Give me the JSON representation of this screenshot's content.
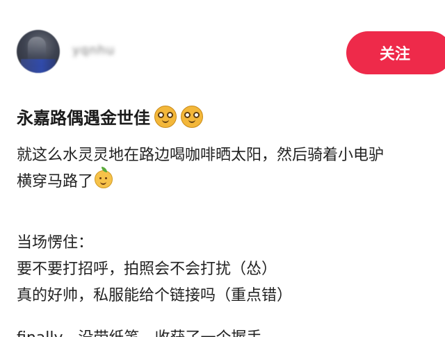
{
  "author": {
    "avatar_icon": "user-avatar-icon",
    "name": "yqnhu"
  },
  "follow_button": {
    "label": "关注",
    "color": "#ee2a4a"
  },
  "post": {
    "title": "永嘉路偶遇金世佳",
    "title_emojis": [
      "nerd-face-icon",
      "nerd-face-icon"
    ],
    "lines": [
      "就这么水灵灵地在路边喝咖啡晒太阳，然后骑着小电驴",
      "横穿马路了",
      "",
      "当场愣住：",
      "要不要打招呼，拍照会不会打扰（怂）",
      "真的好帅，私服能给个链接吗（重点错）",
      "",
      "finally，没带纸笔，收获了一个握手"
    ],
    "inline_emoji": "smiling-face-icon"
  }
}
